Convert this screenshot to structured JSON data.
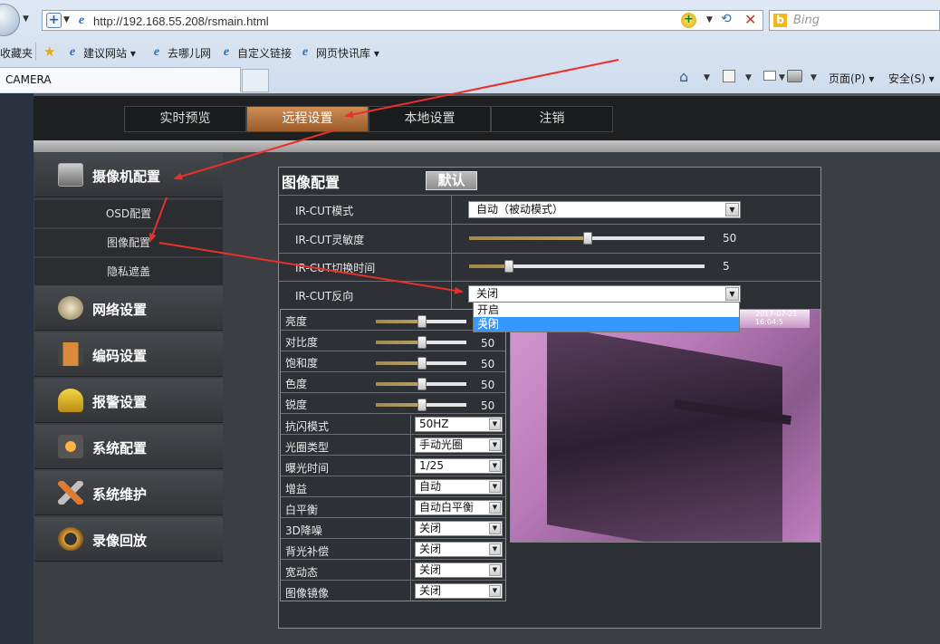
{
  "browser": {
    "url": "http://192.168.55.208/rsmain.html",
    "search_placeholder": "Bing",
    "favorites": {
      "label": "收藏夹",
      "items": [
        "建议网站 ▾",
        "去哪儿网",
        "自定义链接",
        "网页快讯库 ▾"
      ]
    },
    "tab_title": "CAMERA",
    "commands": {
      "page": "页面(P) ▾",
      "safety": "安全(S) ▾"
    }
  },
  "topnav": [
    "实时预览",
    "远程设置",
    "本地设置",
    "注销"
  ],
  "topnav_active": 1,
  "sidebar": {
    "camera_config": "摄像机配置",
    "sub_items": [
      "OSD配置",
      "图像配置",
      "隐私遮盖"
    ],
    "network": "网络设置",
    "encoding": "编码设置",
    "alarm": "报警设置",
    "system_config": "系统配置",
    "maintenance": "系统维护",
    "playback": "录像回放"
  },
  "panel": {
    "title": "图像配置",
    "default_button": "默认",
    "ircut_mode_label": "IR-CUT模式",
    "ircut_mode_value": "自动（被动模式）",
    "ircut_sensitivity_label": "IR-CUT灵敏度",
    "ircut_sensitivity_value": "50",
    "ircut_switch_time_label": "IR-CUT切换时间",
    "ircut_switch_time_value": "5",
    "ircut_reverse_label": "IR-CUT反向",
    "ircut_reverse_value": "关闭",
    "ircut_reverse_options": [
      "开启",
      "关闭"
    ],
    "preview_timestamp": "2017-07-21 16:04:5"
  },
  "image_sliders": [
    {
      "label": "亮度",
      "value": "50"
    },
    {
      "label": "对比度",
      "value": "50"
    },
    {
      "label": "饱和度",
      "value": "50"
    },
    {
      "label": "色度",
      "value": "50"
    },
    {
      "label": "锐度",
      "value": "50"
    }
  ],
  "image_selects": [
    {
      "label": "抗闪模式",
      "value": "50HZ"
    },
    {
      "label": "光圈类型",
      "value": "手动光圈"
    },
    {
      "label": "曝光时间",
      "value": "1/25"
    },
    {
      "label": "增益",
      "value": "自动"
    },
    {
      "label": "白平衡",
      "value": "自动白平衡"
    },
    {
      "label": "3D降噪",
      "value": "关闭"
    },
    {
      "label": "背光补偿",
      "value": "关闭"
    },
    {
      "label": "宽动态",
      "value": "关闭"
    },
    {
      "label": "图像镜像",
      "value": "关闭"
    }
  ],
  "colors": {
    "accent_tab": "#b8753f",
    "annotation_arrow": "#e8312a",
    "highlight": "#3399ff"
  }
}
